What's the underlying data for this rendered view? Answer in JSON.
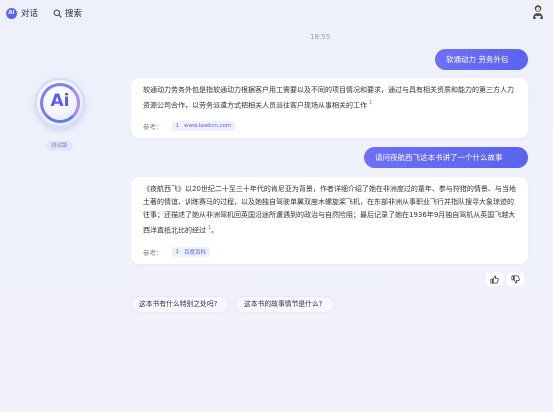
{
  "header": {
    "tabs": [
      {
        "label": "对话",
        "icon": "ai-logo-icon"
      },
      {
        "label": "搜索",
        "icon": "search-icon"
      }
    ],
    "user_icon": "user-avatar-icon"
  },
  "sidebar": {
    "bot_logo_text": "Ai",
    "badge": "测试版"
  },
  "chat": {
    "timestamp": "18:55",
    "messages": [
      {
        "role": "user",
        "text": "软通动力 劳务外包"
      },
      {
        "role": "assistant",
        "text": "软通动力劳务外包是指软通动力根据客户用工需要以及不同的项目情况和要求，通过与具有相关资质和能力的第三方人力资源公司合作，以劳务派遣方式把相关人员派往客户现场从事相关的工作",
        "cite": "1",
        "ref_label": "参考：",
        "refs": [
          {
            "num": "1",
            "source": "www.lawkcn.com"
          }
        ]
      },
      {
        "role": "user",
        "text": "请问夜航西飞这本书讲了一个什么故事"
      },
      {
        "role": "assistant",
        "text": "《夜航西飞》以20世纪二十至三十年代的肯尼亚为背景，作者详细介绍了她在非洲度过的童年、参与狩猎的情景、与当地土著的情谊、训练赛马的过程，以及她独自驾驶单翼双座木螺旋桨飞机，在东部非洲从事职业飞行并指队搜寻大象琼迹的往事；还描述了她从非洲驾机回英国沿途所遭遇到的政治与自然险阻；最后记录了她在1936年9月独自驾机从英国飞越大西洋直抵北比的经过",
        "cite": "1",
        "ref_label": "参考：",
        "refs": [
          {
            "num": "1",
            "source": "百度百科"
          }
        ]
      }
    ],
    "feedback": {
      "like_icon": "thumbs-up-icon",
      "dislike_icon": "thumbs-down-icon"
    },
    "suggestions": [
      "这本书有什么特别之处吗?",
      "这本书的故事情节是什么?"
    ]
  }
}
